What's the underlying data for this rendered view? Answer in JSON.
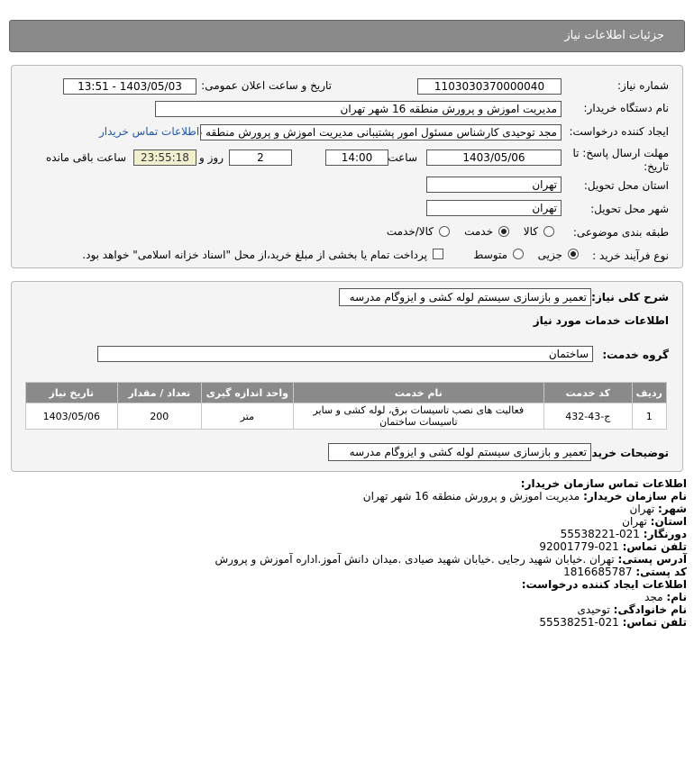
{
  "header": {
    "title": "جزئیات اطلاعات نیاز"
  },
  "form": {
    "need_number_label": "شماره نیاز:",
    "need_number": "1103030370000040",
    "announce_label": "تاریخ و ساعت اعلان عمومی:",
    "announce_value": "1403/05/03 - 13:51",
    "buyer_org_label": "نام دستگاه خریدار:",
    "buyer_org": "مدیریت اموزش و پرورش منطقه 16 شهر تهران",
    "creator_label": "ایجاد کننده درخواست:",
    "creator": "مجد توحیدی کارشناس مسئول امور پشتیبانی مدیریت اموزش و پرورش منطقه 6",
    "contact_link": "اطلاعات تماس خریدار",
    "deadline_label_1": "مهلت ارسال پاسخ: تا",
    "deadline_label_2": "تاریخ:",
    "deadline_date": "1403/05/06",
    "time_label": "ساعت",
    "deadline_time": "14:00",
    "days_value": "2",
    "days_label": "روز و",
    "remaining_time": "23:55:18",
    "remaining_label": "ساعت باقی مانده",
    "province_label": "استان محل تحویل:",
    "province": "تهران",
    "city_label": "شهر محل تحویل:",
    "city": "تهران",
    "category_label": "طبقه بندی موضوعی:",
    "category_options": [
      "کالا",
      "خدمت",
      "کالا/خدمت"
    ],
    "category_selected": "خدمت",
    "process_label": "نوع فرآیند خرید :",
    "process_options": [
      "جزیی",
      "متوسط"
    ],
    "process_selected": "جزیی",
    "payment_note": "پرداخت تمام یا بخشی از مبلغ خرید،از محل \"اسناد خزانه اسلامی\" خواهد بود."
  },
  "summary": {
    "general_label": "شرح کلی نیاز:",
    "general_value": "تعمیر و بازسازی سیستم لوله کشی و ایزوگام مدرسه",
    "services_title": "اطلاعات خدمات مورد نیاز",
    "group_label": "گروه خدمت:",
    "group_value": "ساختمان",
    "table": {
      "headers": [
        "ردیف",
        "کد خدمت",
        "نام خدمت",
        "واحد اندازه گیری",
        "تعداد / مقدار",
        "تاریخ نیاز"
      ],
      "rows": [
        [
          "1",
          "ج-43-432",
          "فعالیت های نصب تاسیسات برق، لوله کشی و سایر تاسیسات ساختمان",
          "متر",
          "200",
          "1403/05/06"
        ]
      ]
    },
    "buyer_notes_label": "توضیحات خریدار:",
    "buyer_notes_value": "تعمیر و بازسازی سیستم لوله کشی و ایزوگام مدرسه"
  },
  "contact": {
    "buyer_heading": "اطلاعات تماس سازمان خریدار:",
    "org_label": "نام سازمان خریدار:",
    "org_value": "مدیریت اموزش و پرورش منطقه 16 شهر تهران",
    "city_label": "شهر:",
    "city_value": "تهران",
    "province_label": "استان:",
    "province_value": "تهران",
    "fax_label": "دورنگار:",
    "fax_value": "021-55538221",
    "phone_label": "تلفن تماس:",
    "phone_value": "021-92001779",
    "address_label": "آدرس پستی:",
    "address_value": "تهران .خیابان شهید رجایی .خیابان شهید صیادی .میدان دانش آموز.اداره آموزش و پرورش",
    "postal_label": "کد پستی:",
    "postal_value": "1816685787",
    "creator_heading": "اطلاعات ایجاد کننده درخواست:",
    "name_label": "نام:",
    "name_value": "مجد",
    "family_label": "نام خانوادگی:",
    "family_value": "توحیدی",
    "creator_phone_label": "تلفن تماس:",
    "creator_phone_value": "021-55538251"
  }
}
